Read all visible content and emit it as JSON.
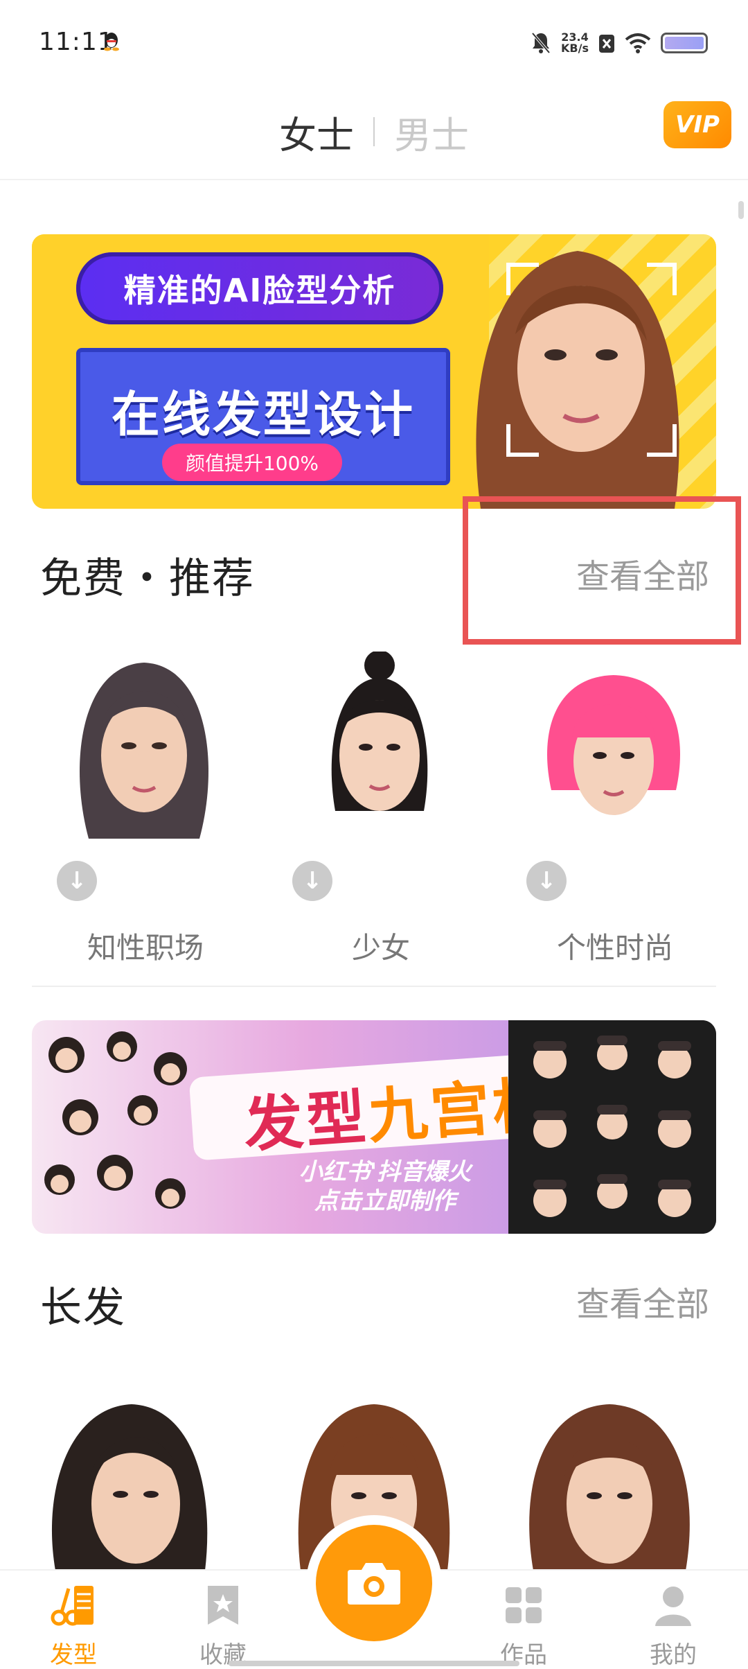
{
  "status_bar": {
    "time": "11:11",
    "network_speed_value": "23.4",
    "network_speed_unit": "KB/s"
  },
  "header": {
    "tabs": [
      {
        "label": "女士",
        "active": true
      },
      {
        "label": "男士",
        "active": false
      }
    ],
    "vip_label": "VIP"
  },
  "banner_top": {
    "pill_text": "精准的AI脸型分析",
    "title": "在线发型设计",
    "subtitle": "颜值提升100%"
  },
  "section_free": {
    "title": "免费・推荐",
    "see_all": "查看全部",
    "items": [
      {
        "label": "知性职场",
        "hair_color": "#4a3f45"
      },
      {
        "label": "少女",
        "hair_color": "#1f1a1a"
      },
      {
        "label": "个性时尚",
        "hair_color": "#ff4f8f"
      }
    ]
  },
  "banner_grid": {
    "title_part1": "发型",
    "title_part2": "九宫格",
    "sub_line1": "小红书'抖音爆火",
    "sub_line2": "点击立即制作"
  },
  "section_long": {
    "title": "长发",
    "see_all": "查看全部",
    "items": [
      {
        "hair_color": "#2a211e"
      },
      {
        "hair_color": "#7a3f22"
      },
      {
        "hair_color": "#6e3a26"
      }
    ]
  },
  "bottom_nav": {
    "items": [
      {
        "label": "发型",
        "active": true
      },
      {
        "label": "收藏",
        "active": false
      },
      {
        "label": "作品",
        "active": false
      },
      {
        "label": "我的",
        "active": false
      }
    ]
  },
  "colors": {
    "accent": "#ff9a00",
    "highlight_box": "#e95454"
  }
}
